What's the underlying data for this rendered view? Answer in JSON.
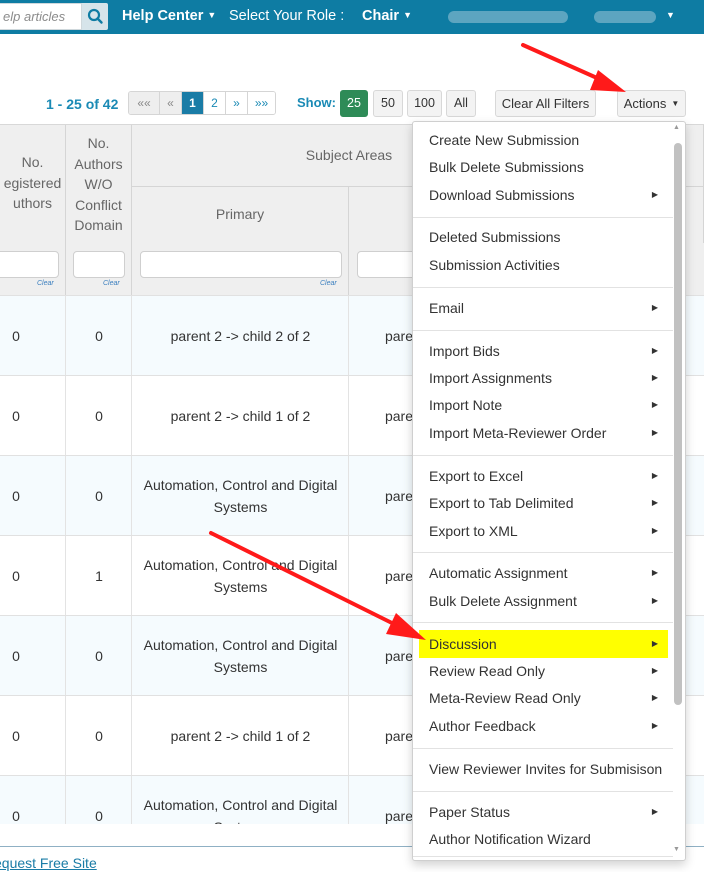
{
  "topbar": {
    "search_placeholder": "elp articles",
    "help_center": "Help Center",
    "role_label": "Select Your Role :",
    "role_value": "Chair",
    "bg_color": "#0e7ca3"
  },
  "toolbar": {
    "range_text": "1 - 25 of 42",
    "pager": {
      "first": "««",
      "prev": "«",
      "pages": [
        "1",
        "2"
      ],
      "active_page": "1",
      "next": "»",
      "last": "»»"
    },
    "show_label": "Show:",
    "show_options": [
      "25",
      "50",
      "100",
      "All"
    ],
    "show_selected": "25",
    "clear_filters": "Clear All Filters",
    "actions": "Actions"
  },
  "table": {
    "headers": {
      "registered_authors": [
        "No.",
        "egistered",
        "uthors"
      ],
      "authors_wo_conflict": [
        "No.",
        "Authors",
        "W/O",
        "Conflict",
        "Domain"
      ],
      "subject_areas": "Subject Areas",
      "primary": "Primary"
    },
    "clear_label": "Clear",
    "rows": [
      {
        "registered": "0",
        "wo_conflict": "0",
        "primary": "parent 2 -> child 2 of 2",
        "secondary": "pare"
      },
      {
        "registered": "0",
        "wo_conflict": "0",
        "primary": "parent 2 -> child 1 of 2",
        "secondary": "pare"
      },
      {
        "registered": "0",
        "wo_conflict": "0",
        "primary": "Automation, Control and Digital Systems",
        "secondary": "pare"
      },
      {
        "registered": "0",
        "wo_conflict": "1",
        "primary": "Automation, Control and Digital Systems",
        "secondary": "pare"
      },
      {
        "registered": "0",
        "wo_conflict": "0",
        "primary": "Automation, Control and Digital Systems",
        "secondary": "pare"
      },
      {
        "registered": "0",
        "wo_conflict": "0",
        "primary": "parent 2 -> child 1 of 2",
        "secondary": "pare"
      },
      {
        "registered": "0",
        "wo_conflict": "0",
        "primary": "Automation, Control and Digital Systems",
        "secondary": "pare"
      }
    ]
  },
  "actions_menu": {
    "items": [
      {
        "label": "Create New Submission",
        "submenu": false
      },
      {
        "label": "Bulk Delete Submissions",
        "submenu": false
      },
      {
        "label": "Download Submissions",
        "submenu": true
      },
      {
        "label": "Deleted Submissions",
        "submenu": false
      },
      {
        "label": "Submission Activities",
        "submenu": false
      },
      {
        "label": "Email",
        "submenu": true
      },
      {
        "label": "Import Bids",
        "submenu": true
      },
      {
        "label": "Import Assignments",
        "submenu": true
      },
      {
        "label": "Import Note",
        "submenu": true
      },
      {
        "label": "Import Meta-Reviewer Order",
        "submenu": true
      },
      {
        "label": "Export to Excel",
        "submenu": true
      },
      {
        "label": "Export to Tab Delimited",
        "submenu": true
      },
      {
        "label": "Export to XML",
        "submenu": true
      },
      {
        "label": "Automatic Assignment",
        "submenu": true
      },
      {
        "label": "Bulk Delete Assignment",
        "submenu": true
      },
      {
        "label": "Discussion",
        "submenu": true,
        "highlighted": true
      },
      {
        "label": "Review Read Only",
        "submenu": true
      },
      {
        "label": "Meta-Review Read Only",
        "submenu": true
      },
      {
        "label": "Author Feedback",
        "submenu": true
      },
      {
        "label": "View Reviewer Invites for Submisison",
        "submenu": false
      },
      {
        "label": "Paper Status",
        "submenu": true
      },
      {
        "label": "Author Notification Wizard",
        "submenu": false
      }
    ],
    "highlight_color": "#ffff00"
  },
  "footer": {
    "link": "equest Free Site"
  },
  "annotation_color": "#ff1a1a"
}
